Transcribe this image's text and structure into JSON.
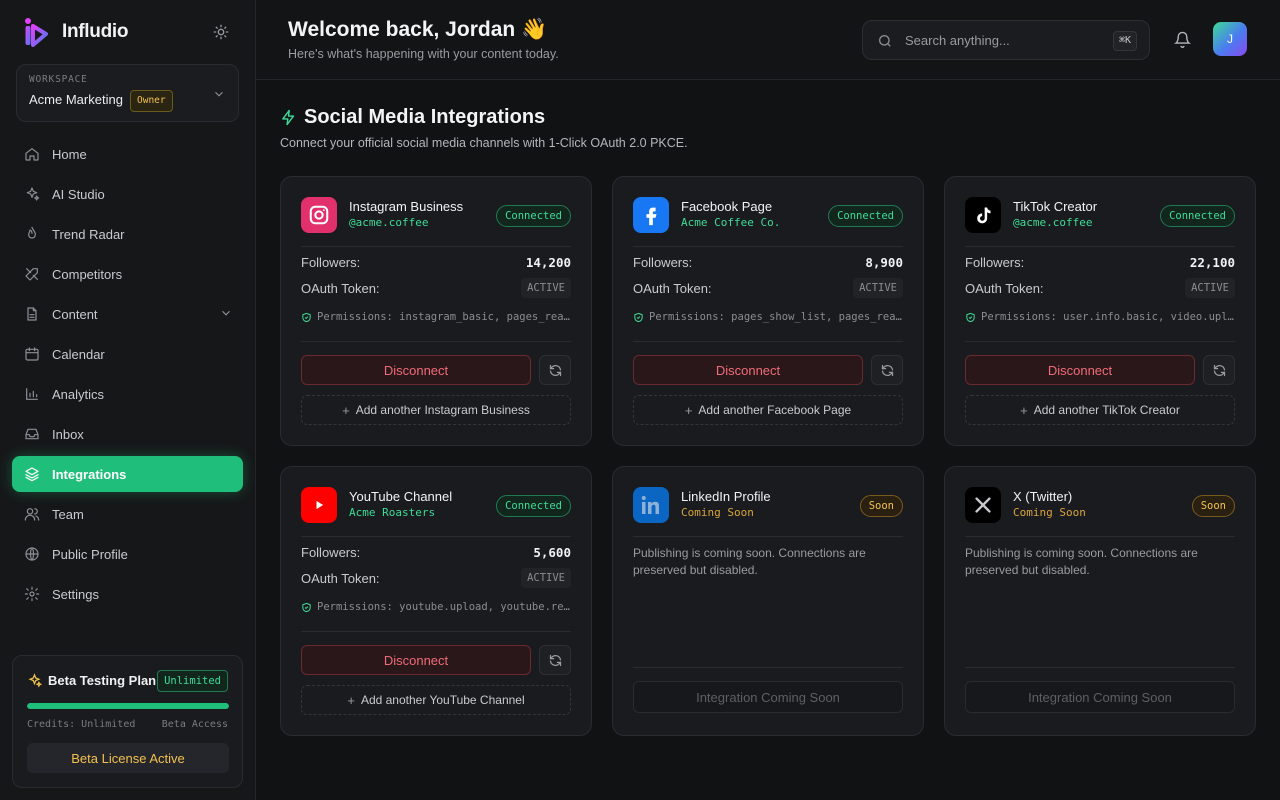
{
  "app": {
    "name": "Infludio"
  },
  "workspace": {
    "label": "WORKSPACE",
    "name": "Acme Marketing",
    "role": "Owner"
  },
  "nav": [
    {
      "label": "Home",
      "icon": "home-icon"
    },
    {
      "label": "AI Studio",
      "icon": "sparkles-icon"
    },
    {
      "label": "Trend Radar",
      "icon": "flame-icon"
    },
    {
      "label": "Competitors",
      "icon": "swords-icon"
    },
    {
      "label": "Content",
      "icon": "document-icon",
      "expandable": true
    },
    {
      "label": "Calendar",
      "icon": "calendar-icon"
    },
    {
      "label": "Analytics",
      "icon": "bar-chart-icon"
    },
    {
      "label": "Inbox",
      "icon": "inbox-icon"
    },
    {
      "label": "Integrations",
      "icon": "layers-icon",
      "active": true
    },
    {
      "label": "Team",
      "icon": "users-icon"
    },
    {
      "label": "Public Profile",
      "icon": "globe-icon"
    },
    {
      "label": "Settings",
      "icon": "gear-icon"
    }
  ],
  "plan": {
    "title": "Beta Testing Plan",
    "badge": "Unlimited",
    "progress": 1.0,
    "credits": "Credits: Unlimited",
    "access": "Beta Access",
    "button": "Beta License Active"
  },
  "header": {
    "welcome": "Welcome back, Jordan 👋",
    "subtitle": "Here's what's happening with your content today.",
    "search_placeholder": "Search anything...",
    "shortcut": "⌘K",
    "avatar_initial": "J"
  },
  "section": {
    "title": "Social Media Integrations",
    "subtitle": "Connect your official social media channels with 1-Click OAuth 2.0 PKCE."
  },
  "labels": {
    "followers": "Followers:",
    "oauth_token": "OAuth Token:",
    "disconnect": "Disconnect",
    "coming_soon_button": "Integration Coming Soon"
  },
  "integrations": [
    {
      "name": "Instagram Business",
      "handle": "@acme.coffee",
      "status": "Connected",
      "followers": "14,200",
      "token": "ACTIVE",
      "permissions": "Permissions: instagram_basic, pages_read_engagement",
      "add_label": "Add another Instagram Business",
      "icon": "instagram-icon",
      "color": "#e1306c"
    },
    {
      "name": "Facebook Page",
      "handle": "Acme Coffee Co.",
      "status": "Connected",
      "followers": "8,900",
      "token": "ACTIVE",
      "permissions": "Permissions: pages_show_list, pages_read_engagement",
      "add_label": "Add another Facebook Page",
      "icon": "facebook-icon",
      "color": "#1877f2"
    },
    {
      "name": "TikTok Creator",
      "handle": "@acme.coffee",
      "status": "Connected",
      "followers": "22,100",
      "token": "ACTIVE",
      "permissions": "Permissions: user.info.basic, video.upload",
      "add_label": "Add another TikTok Creator",
      "icon": "tiktok-icon",
      "color": "#000000"
    },
    {
      "name": "YouTube Channel",
      "handle": "Acme Roasters",
      "status": "Connected",
      "followers": "5,600",
      "token": "ACTIVE",
      "permissions": "Permissions: youtube.upload, youtube.readonly",
      "add_label": "Add another YouTube Channel",
      "icon": "youtube-icon",
      "color": "#ff0000"
    },
    {
      "name": "LinkedIn Profile",
      "handle": "Coming Soon",
      "status": "Soon",
      "description": "Publishing is coming soon. Connections are preserved but disabled.",
      "icon": "linkedin-icon",
      "color": "#0a66c2"
    },
    {
      "name": "X (Twitter)",
      "handle": "Coming Soon",
      "status": "Soon",
      "description": "Publishing is coming soon. Connections are preserved but disabled.",
      "icon": "x-icon",
      "color": "#000000"
    }
  ]
}
